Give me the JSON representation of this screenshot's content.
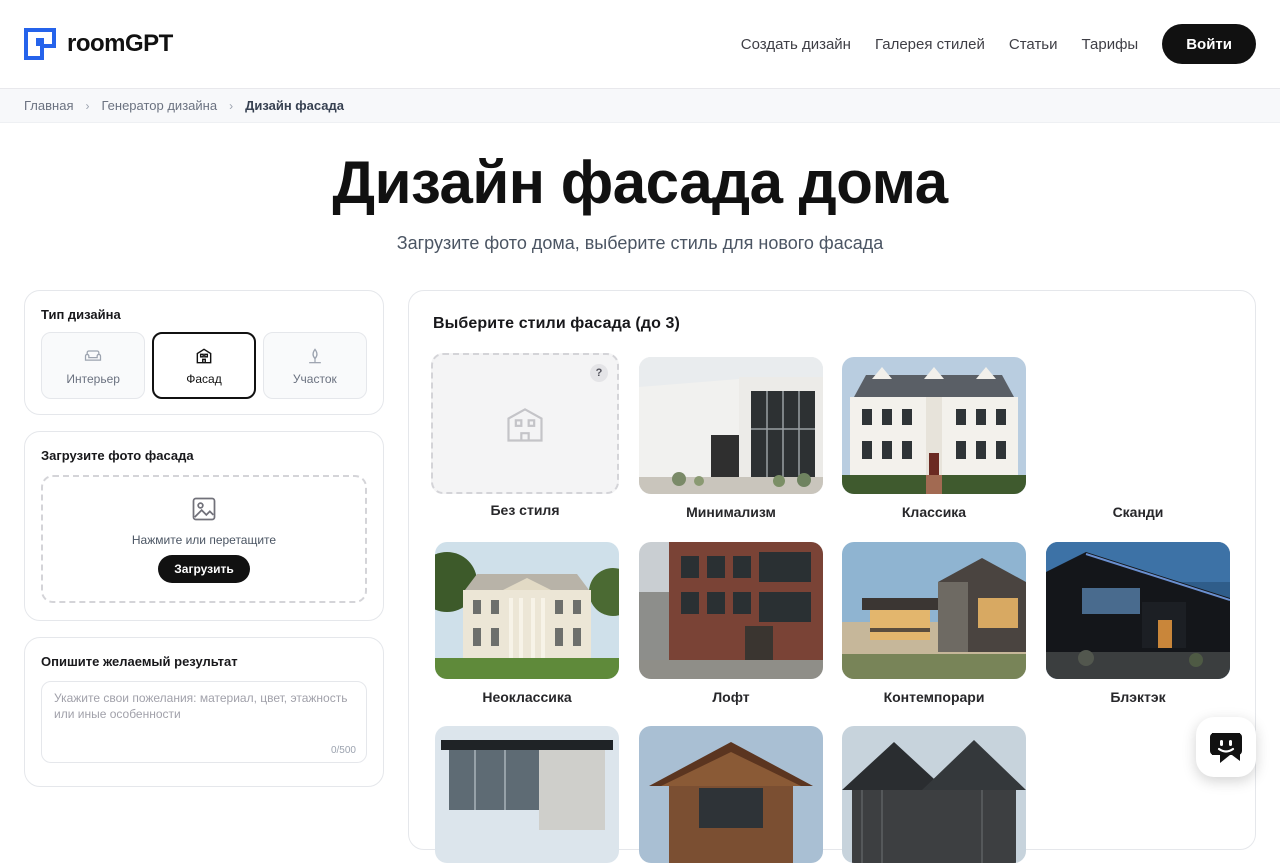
{
  "brand": {
    "name_part1": "room",
    "name_part2": "GPT",
    "accent_color": "#2563eb"
  },
  "nav": {
    "items": [
      {
        "label": "Создать дизайн"
      },
      {
        "label": "Галерея стилей"
      },
      {
        "label": "Статьи"
      },
      {
        "label": "Тарифы"
      }
    ],
    "login_label": "Войти"
  },
  "breadcrumb": {
    "items": [
      "Главная",
      "Генератор дизайна",
      "Дизайн фасада"
    ],
    "separator": "›"
  },
  "hero": {
    "title": "Дизайн фасада дома",
    "subtitle": "Загрузите фото дома, выберите стиль для нового фасада"
  },
  "design_type": {
    "title": "Тип дизайна",
    "options": [
      {
        "label": "Интерьер",
        "icon": "sofa-icon",
        "active": false
      },
      {
        "label": "Фасад",
        "icon": "house-icon",
        "active": true
      },
      {
        "label": "Участок",
        "icon": "plant-icon",
        "active": false
      }
    ]
  },
  "upload": {
    "title": "Загрузите фото фасада",
    "hint": "Нажмите или перетащите",
    "button_label": "Загрузить"
  },
  "description": {
    "title": "Опишите желаемый результат",
    "placeholder": "Укажите свои пожелания: материал, цвет, этажность или иные особенности",
    "counter": "0/500"
  },
  "styles": {
    "title": "Выберите стили фасада (до 3)",
    "help_badge": "?",
    "items": [
      {
        "label": "Без стиля"
      },
      {
        "label": "Минимализм"
      },
      {
        "label": "Классика"
      },
      {
        "label": "Сканди"
      },
      {
        "label": "Неоклассика"
      },
      {
        "label": "Лофт"
      },
      {
        "label": "Контемпорари"
      },
      {
        "label": "Блэктэк"
      }
    ]
  }
}
